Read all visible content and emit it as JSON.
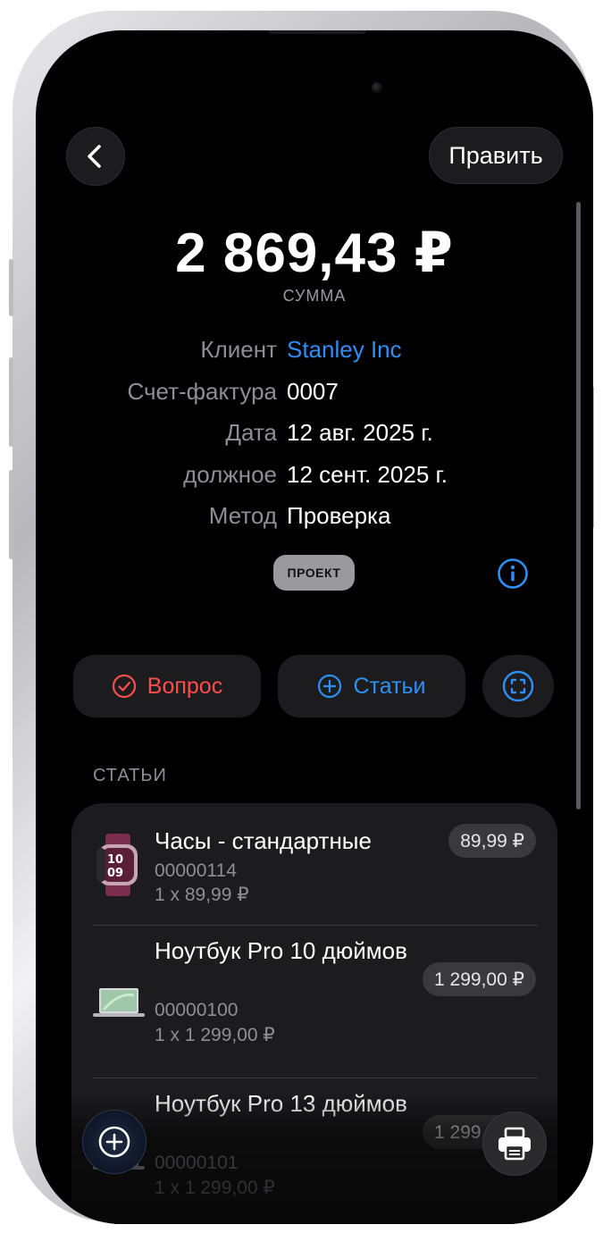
{
  "nav": {
    "edit_label": "Править"
  },
  "summary": {
    "amount": "2 869,43 ₽",
    "amount_label": "СУММА"
  },
  "details": [
    {
      "label": "Клиент",
      "value": "Stanley Inc",
      "is_link": true
    },
    {
      "label": "Счет-фактура",
      "value": "0007",
      "is_link": false
    },
    {
      "label": "Дата",
      "value": "12 авг. 2025 г.",
      "is_link": false
    },
    {
      "label": "должное",
      "value": "12 сент. 2025 г.",
      "is_link": false
    },
    {
      "label": "Метод",
      "value": "Проверка",
      "is_link": false
    }
  ],
  "status_badge": "ПРОЕКТ",
  "actions": {
    "issue_label": "Вопрос",
    "items_label": "Статьи"
  },
  "section_title": "СТАТЬИ",
  "items": [
    {
      "name": "Часы - стандартные",
      "sku": "00000114",
      "qty": "1 x 89,99 ₽",
      "price": "89,99 ₽",
      "thumb": "watch-thumbnail"
    },
    {
      "name": "Ноутбук Pro 10 дюймов",
      "sku": "00000100",
      "qty": "1 x 1 299,00 ₽",
      "price": "1 299,00 ₽",
      "thumb": "laptop-thumbnail"
    },
    {
      "name": "Ноутбук Pro 13 дюймов",
      "sku": "00000101",
      "qty": "1 x 1 299,00 ₽",
      "price": "1 299,00 ₽",
      "thumb": "laptop-thumbnail"
    }
  ],
  "colors": {
    "background": "#000000",
    "card": "#1c1c1e",
    "accent": "#2f8ff6",
    "danger": "#ff4d4d",
    "secondary_text": "#8e8e93"
  },
  "icons": [
    "chevron-left-icon",
    "info-icon",
    "checkmark-circle-icon",
    "plus-circle-icon",
    "scan-icon",
    "plus-icon",
    "printer-icon"
  ]
}
